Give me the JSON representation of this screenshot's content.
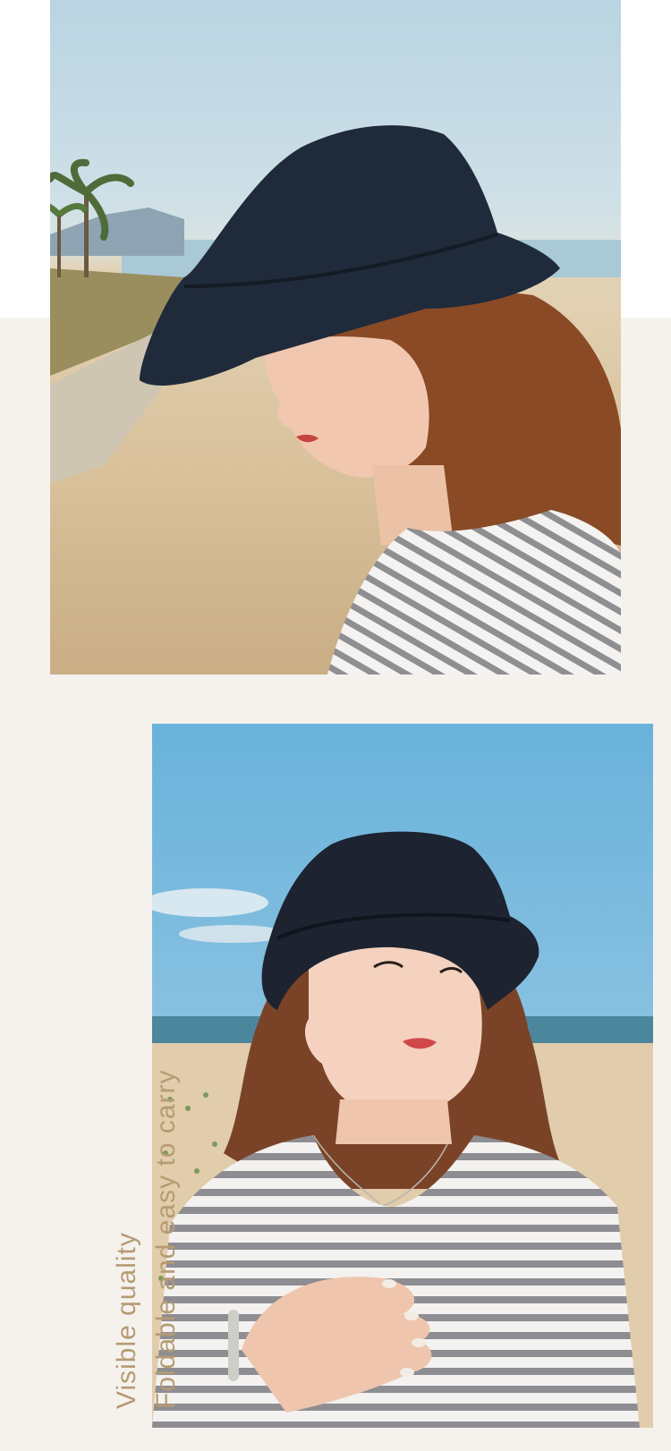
{
  "caption": {
    "line1": "Visible quality",
    "line2": "Foldable and easy to carry"
  },
  "photos": [
    {
      "name": "woman-profile-bucket-hat-beach"
    },
    {
      "name": "woman-front-bucket-hat-beach"
    }
  ],
  "colors": {
    "background": "#f5f2ee",
    "caption": "#b59b73",
    "hat": "#1f2a3a"
  }
}
